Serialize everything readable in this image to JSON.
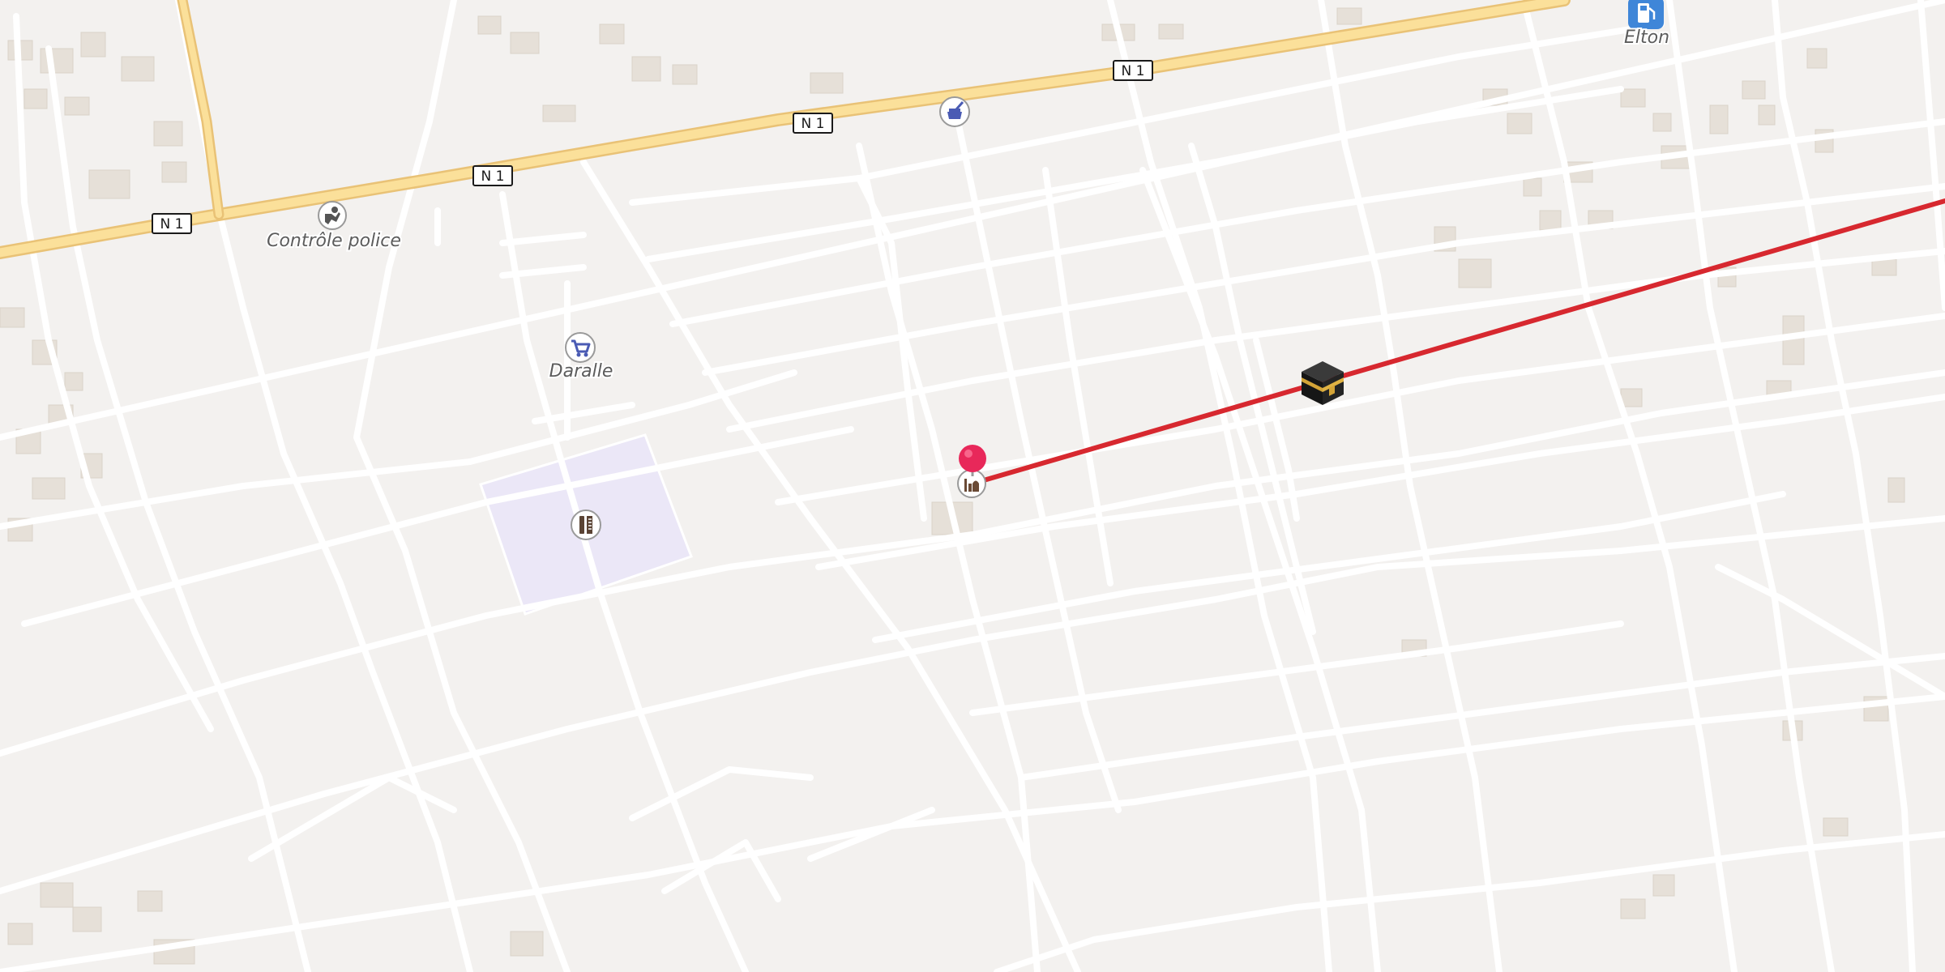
{
  "map": {
    "roads": {
      "n1_shields": [
        "N 1",
        "N 1",
        "N 1",
        "N 1"
      ]
    },
    "pois": [
      {
        "name": "Contrôle police",
        "icon": "police-icon"
      },
      {
        "name": "Daralle",
        "icon": "shopping-cart-icon"
      },
      {
        "name": "Elton",
        "icon": "fuel-station-icon"
      },
      {
        "name": "",
        "icon": "pharmacy-icon"
      },
      {
        "name": "",
        "icon": "mosque-icon"
      },
      {
        "name": "",
        "icon": "school-icon"
      }
    ],
    "markers": {
      "pin_color": "#e8285a",
      "qibla_line_color": "#d7282f",
      "kaaba_icon": "kaaba-icon"
    },
    "colors": {
      "land": "#f3f1ef",
      "road": "#ffffff",
      "major_road": "#fbe09a",
      "major_road_casing": "#e9c276",
      "building": "#e6e0d8",
      "landuse": "#ebe7f7"
    }
  }
}
